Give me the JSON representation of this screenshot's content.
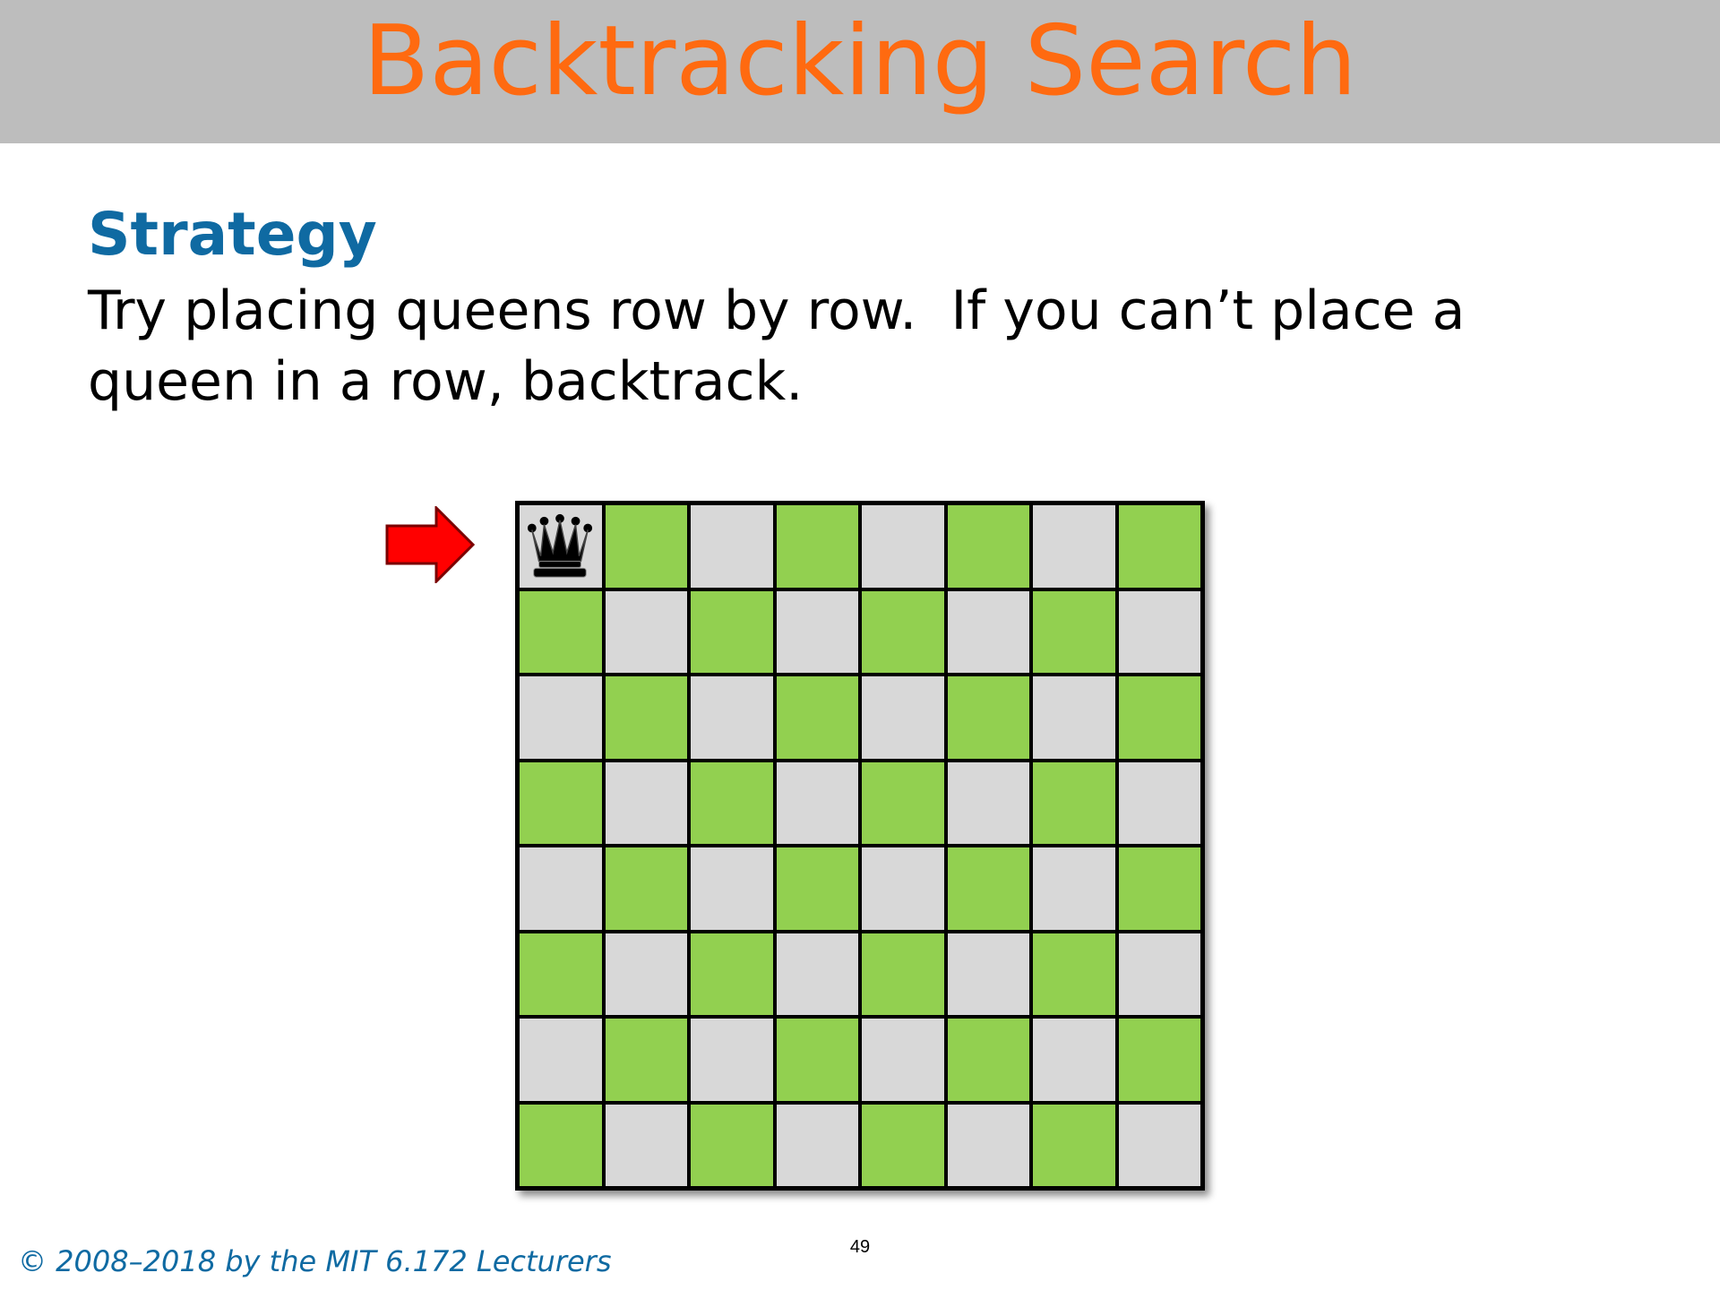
{
  "slide": {
    "title": "Backtracking Search",
    "heading": "Strategy",
    "body_lines": [
      "Try placing queens row by row.  If you can’t place a",
      "queen in a row, backtrack."
    ],
    "copyright": "© 2008–2018 by the MIT 6.172 Lecturers",
    "page_number": "49"
  },
  "board": {
    "rows": 8,
    "cols": 8,
    "queens": [
      {
        "row": 1,
        "col": 1
      }
    ],
    "current_row": 1,
    "colors": {
      "light": "#d8d8d8",
      "dark": "#92d050",
      "queen": "#000000",
      "arrow": "#ff0000"
    }
  },
  "colors": {
    "title_bar": "#bdbdbd",
    "title": "#ff6a10",
    "heading": "#0f6aa2",
    "footer": "#0f6aa2"
  },
  "icons": {
    "queen": "chess-queen-icon",
    "arrow": "red-right-arrow-icon"
  }
}
